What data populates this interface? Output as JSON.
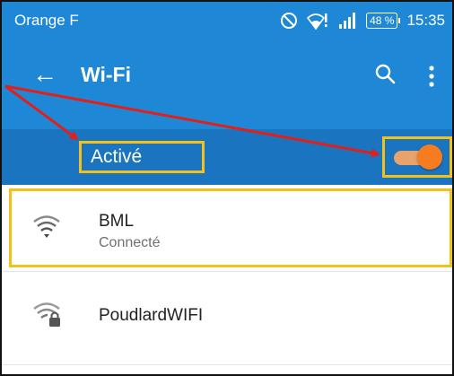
{
  "status_bar": {
    "carrier": "Orange F",
    "battery": "48 %",
    "time": "15:35",
    "icons": [
      "do-not-disturb-icon",
      "wifi-alert-icon",
      "signal-icon",
      "battery-icon"
    ]
  },
  "toolbar": {
    "back_icon": "arrow-left-icon",
    "title": "Wi-Fi",
    "search_icon": "search-icon",
    "more_icon": "more-vert-icon"
  },
  "wifi_switch": {
    "label": "Activé",
    "enabled": true
  },
  "networks": [
    {
      "ssid": "BML",
      "status": "Connecté",
      "icon": "wifi-signal-icon"
    },
    {
      "ssid": "PoudlardWIFI",
      "status": "",
      "icon": "wifi-locked-icon"
    }
  ],
  "colors": {
    "toolbar": "#1e88d6",
    "switch_bar": "#1a74bf",
    "highlight": "#f3c21a",
    "annotation_arrow": "#e0201b",
    "toggle_on": "#f57c1f"
  }
}
